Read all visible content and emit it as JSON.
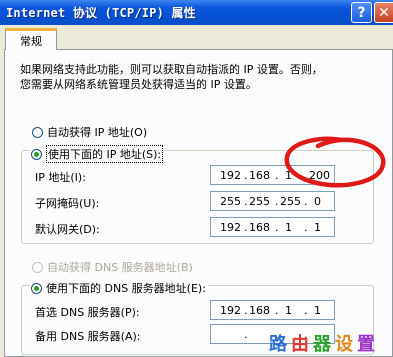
{
  "window": {
    "title": "Internet 协议 (TCP/IP) 属性",
    "help_label": "?",
    "close_label": "✕"
  },
  "tabs": [
    {
      "label": "常规",
      "active": true
    }
  ],
  "description": {
    "line1": "如果网络支持此功能，则可以获取自动指派的 IP 设置。否则，",
    "line2": "您需要从网络系统管理员处获得适当的 IP 设置。"
  },
  "ip_mode": {
    "auto_label": "自动获得 IP 地址(O)",
    "manual_label": "使用下面的 IP 地址(S):",
    "selected": "manual"
  },
  "ip_fields": [
    {
      "label": "IP 地址(I):",
      "octets": [
        "192",
        "168",
        "1",
        "200"
      ]
    },
    {
      "label": "子网掩码(U):",
      "octets": [
        "255",
        "255",
        "255",
        "0"
      ]
    },
    {
      "label": "默认网关(D):",
      "octets": [
        "192",
        "168",
        "1",
        "1"
      ]
    }
  ],
  "dns_mode": {
    "auto_label": "自动获得 DNS 服务器地址(B)",
    "manual_label": "使用下面的 DNS 服务器地址(E):",
    "selected": "manual",
    "auto_disabled": true
  },
  "dns_fields": [
    {
      "label": "首选 DNS 服务器(P):",
      "octets": [
        "192",
        "168",
        "1",
        "1"
      ]
    },
    {
      "label": "备用 DNS 服务器(A):",
      "octets": [
        "",
        "",
        "",
        ""
      ]
    }
  ],
  "watermark": {
    "chars": [
      "路",
      "由",
      "器",
      "设",
      "置"
    ],
    "colors": [
      "#2f6fd8",
      "#e0342c",
      "#2ca02c",
      "#e08a1c",
      "#9a35c8"
    ]
  }
}
